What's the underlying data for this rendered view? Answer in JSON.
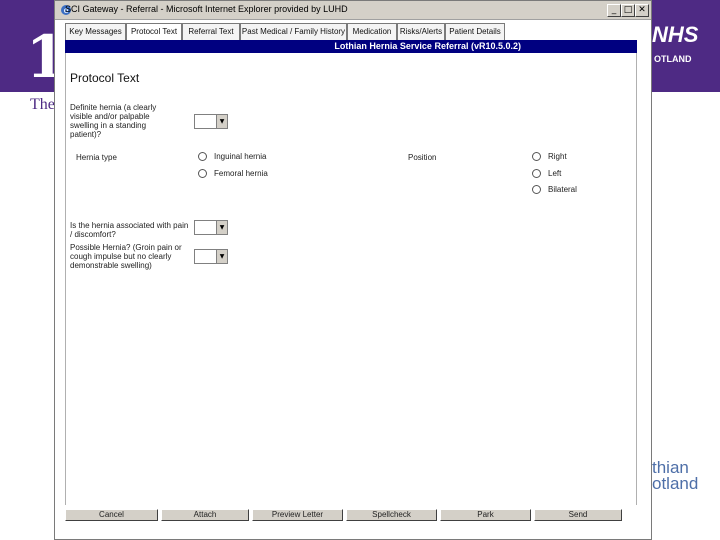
{
  "background": {
    "logo_left": "1",
    "the_text": "The",
    "nhs_text": "NHS",
    "scotland_text": "OTLAND",
    "lothian_line1": "thian",
    "lothian_line2": "otland",
    "brand_color": "#4e2a84"
  },
  "window": {
    "title": "SCI Gateway - Referral - Microsoft Internet Explorer provided by LUHD",
    "minimize": "_",
    "maximize": "□",
    "close": "✕"
  },
  "tabs": [
    {
      "label": "Key Messages"
    },
    {
      "label": "Protocol Text"
    },
    {
      "label": "Referral Text"
    },
    {
      "label": "Past Medical / Family History"
    },
    {
      "label": "Medication"
    },
    {
      "label": "Risks/Alerts"
    },
    {
      "label": "Patient Details"
    }
  ],
  "header": {
    "title": "Lothian Hernia Service Referral (vR10.5.0.2)",
    "bar_color": "#000080"
  },
  "protocol": {
    "heading": "Protocol Text",
    "q1": "Definite hernia (a clearly visible and/or palpable swelling in a standing patient)?",
    "hernia_type_label": "Hernia type",
    "hernia_types": [
      "Inguinal hernia",
      "Femoral hernia"
    ],
    "position_label": "Position",
    "positions": [
      "Right",
      "Left",
      "Bilateral"
    ],
    "q2": "Is the hernia associated with pain / discomfort?",
    "q3": "Possible Hernia? (Groin pain or cough impulse but no clearly demonstrable swelling)"
  },
  "footer": {
    "buttons": [
      "Cancel",
      "Attach",
      "Preview Letter",
      "Spellcheck",
      "Park",
      "Send"
    ]
  }
}
